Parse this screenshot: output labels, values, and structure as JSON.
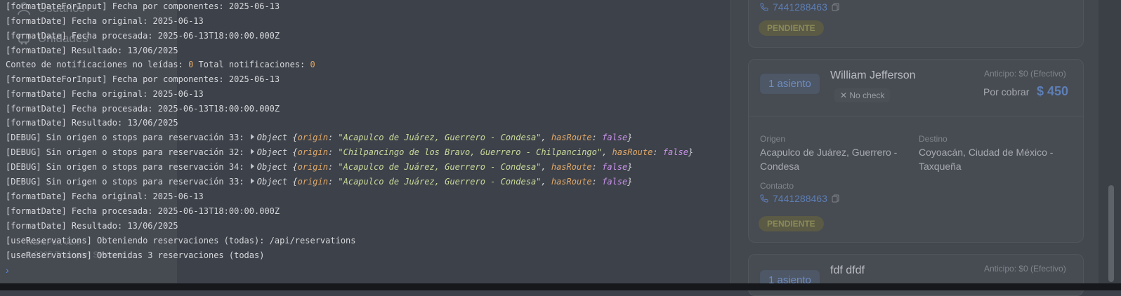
{
  "sidebar": {
    "items": [
      {
        "label": "Usuarios",
        "icon": "user-icon"
      },
      {
        "label": "Unidades",
        "icon": "bus-icon"
      }
    ],
    "footer_line1": "TransPort v1.0",
    "footer_line2": "© 2025 Transport Systems"
  },
  "reservations": {
    "top_card": {
      "phone": "7441288463",
      "status": "PENDIENTE"
    },
    "card_main": {
      "seats": "1 asiento",
      "name": "William Jefferson",
      "check": "No check",
      "anticipo": "Anticipo: $0 (Efectivo)",
      "por_cobrar_label": "Por cobrar",
      "por_cobrar_amount": "$ 450",
      "origen_label": "Origen",
      "origen_value": "Acapulco de Juárez, Guerrero - Condesa",
      "destino_label": "Destino",
      "destino_value": "Coyoacán, Ciudad de México - Taxqueña",
      "contacto_label": "Contacto",
      "phone": "7441288463",
      "status": "PENDIENTE"
    },
    "card_bottom": {
      "seats": "1 asiento",
      "name": "fdf dfdf",
      "anticipo": "Anticipo: $0 (Efectivo)"
    }
  },
  "console": {
    "lines": [
      {
        "kind": "text",
        "text": "[formatDateForInput] Fecha por componentes: 2025-06-13"
      },
      {
        "kind": "text",
        "text": "[formatDate] Fecha original: 2025-06-13"
      },
      {
        "kind": "text",
        "text": "[formatDate] Fecha procesada: 2025-06-13T18:00:00.000Z"
      },
      {
        "kind": "text",
        "text": "[formatDate] Resultado: 13/06/2025"
      },
      {
        "kind": "count",
        "pre": "Conteo de notificaciones no leídas: ",
        "n1": "0",
        "mid": " Total notificaciones: ",
        "n2": "0"
      },
      {
        "kind": "text",
        "text": "[formatDateForInput] Fecha por componentes: 2025-06-13"
      },
      {
        "kind": "text",
        "text": "[formatDate] Fecha original: 2025-06-13"
      },
      {
        "kind": "text",
        "text": "[formatDate] Fecha procesada: 2025-06-13T18:00:00.000Z"
      },
      {
        "kind": "text",
        "text": "[formatDate] Resultado: 13/06/2025"
      },
      {
        "kind": "object",
        "pre": "[DEBUG] Sin origen o stops para reservación 33: ",
        "label": "Object ",
        "origin": "\"Acapulco de Juárez, Guerrero - Condesa\"",
        "hasRoute": "false"
      },
      {
        "kind": "object",
        "pre": "[DEBUG] Sin origen o stops para reservación 32: ",
        "label": "Object ",
        "origin": "\"Chilpancingo de los Bravo, Guerrero - Chilpancingo\"",
        "hasRoute": "false"
      },
      {
        "kind": "object",
        "pre": "[DEBUG] Sin origen o stops para reservación 34: ",
        "label": "Object ",
        "origin": "\"Acapulco de Juárez, Guerrero - Condesa\"",
        "hasRoute": "false"
      },
      {
        "kind": "object",
        "pre": "[DEBUG] Sin origen o stops para reservación 33: ",
        "label": "Object ",
        "origin": "\"Acapulco de Juárez, Guerrero - Condesa\"",
        "hasRoute": "false"
      },
      {
        "kind": "text",
        "text": "[formatDate] Fecha original: 2025-06-13"
      },
      {
        "kind": "text",
        "text": "[formatDate] Fecha procesada: 2025-06-13T18:00:00.000Z"
      },
      {
        "kind": "text",
        "text": "[formatDate] Resultado: 13/06/2025"
      },
      {
        "kind": "text",
        "text": "[useReservations] Obteniendo reservaciones (todas): /api/reservations"
      },
      {
        "kind": "text",
        "text": "[useReservations] Obtenidas 3 reservaciones (todas)"
      }
    ],
    "object_keys": {
      "origin": "origin",
      "hasRoute": "hasRoute"
    },
    "prompt": "›"
  }
}
